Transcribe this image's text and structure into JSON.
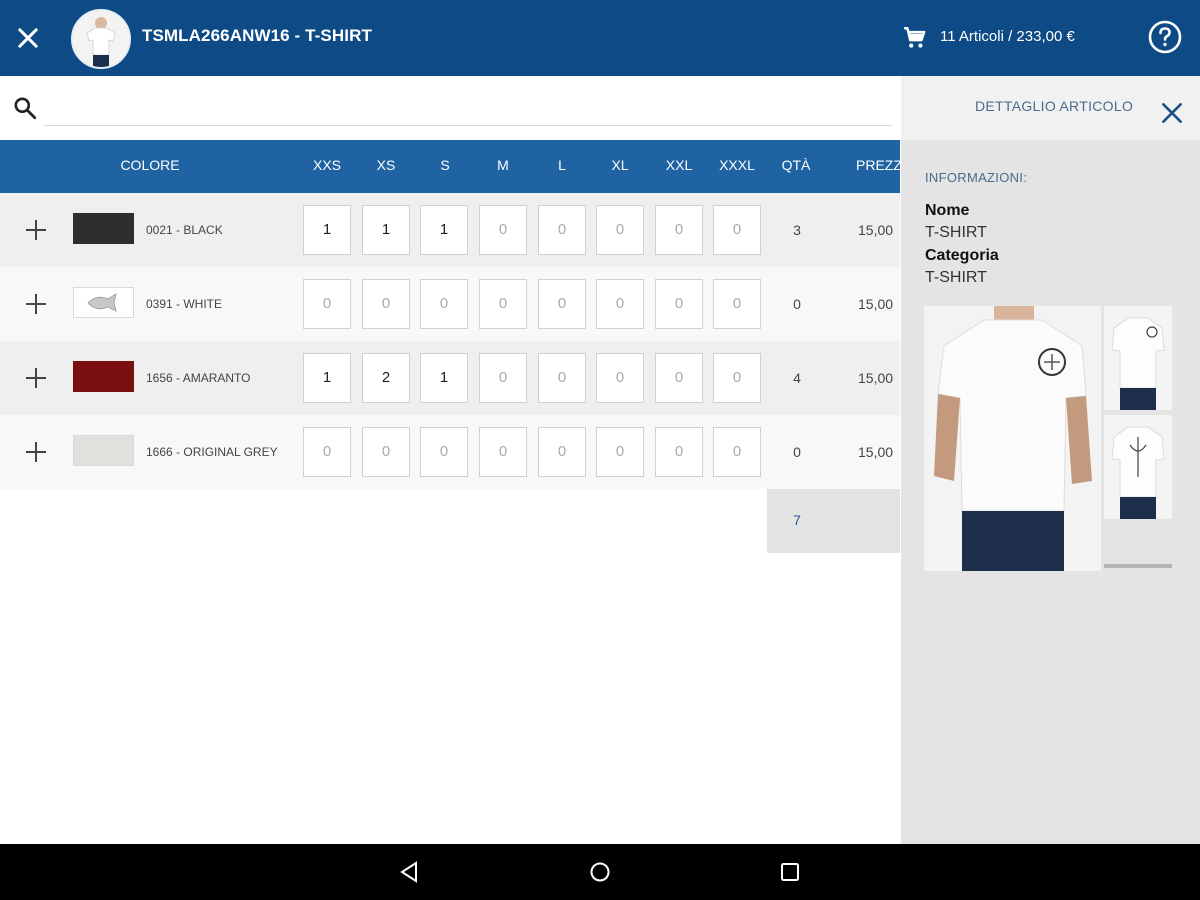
{
  "header": {
    "title": "TSMLA266ANW16 - T-SHIRT",
    "cart_summary": "11 Articoli / 233,00 €"
  },
  "search": {
    "placeholder": ""
  },
  "table": {
    "color_header": "COLORE",
    "sizes": [
      "XXS",
      "XS",
      "S",
      "M",
      "L",
      "XL",
      "XXL",
      "XXXL"
    ],
    "qty_header": "QTÀ",
    "price_header": "PREZZ",
    "rows": [
      {
        "color": "0021 - BLACK",
        "swatch": "#2e2e2e",
        "quantities": [
          "1",
          "1",
          "1",
          "0",
          "0",
          "0",
          "0",
          "0"
        ],
        "qty": "3",
        "price": "15,00"
      },
      {
        "color": "0391 - WHITE",
        "swatch": "#ffffff",
        "quantities": [
          "0",
          "0",
          "0",
          "0",
          "0",
          "0",
          "0",
          "0"
        ],
        "qty": "0",
        "price": "15,00"
      },
      {
        "color": "1656 - AMARANTO",
        "swatch": "#7a1010",
        "quantities": [
          "1",
          "2",
          "1",
          "0",
          "0",
          "0",
          "0",
          "0"
        ],
        "qty": "4",
        "price": "15,00"
      },
      {
        "color": "1666 - ORIGINAL GREY",
        "swatch": "#e2e0dc",
        "quantities": [
          "0",
          "0",
          "0",
          "0",
          "0",
          "0",
          "0",
          "0"
        ],
        "qty": "0",
        "price": "15,00"
      }
    ],
    "total_qty": "7"
  },
  "detail_panel": {
    "title": "DETTAGLIO ARTICOLO",
    "section_label": "INFORMAZIONI:",
    "name_label": "Nome",
    "name_value": "T-SHIRT",
    "category_label": "Categoria",
    "category_value": "T-SHIRT"
  },
  "colors": {
    "header_bg": "#0d4a86",
    "table_header_bg": "#1f63a3",
    "panel_bg": "#e4e4e4",
    "accent_text": "#4a6b8d"
  },
  "icons": [
    "close-icon",
    "cart-icon",
    "help-icon",
    "search-icon",
    "plus-icon",
    "back-icon",
    "home-icon",
    "recents-icon"
  ]
}
